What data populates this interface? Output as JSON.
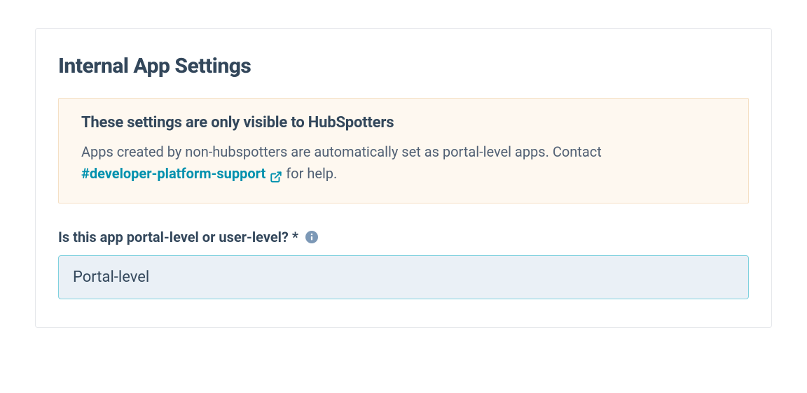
{
  "header": {
    "title": "Internal App Settings"
  },
  "notice": {
    "title": "These settings are only visible to HubSpotters",
    "body_prefix": "Apps created by non-hubspotters are automatically set as portal-level apps. Contact ",
    "channel_link": "#developer-platform-support",
    "body_suffix": " for help."
  },
  "field": {
    "label": "Is this app portal-level or user-level? *",
    "value": "Portal-level"
  }
}
